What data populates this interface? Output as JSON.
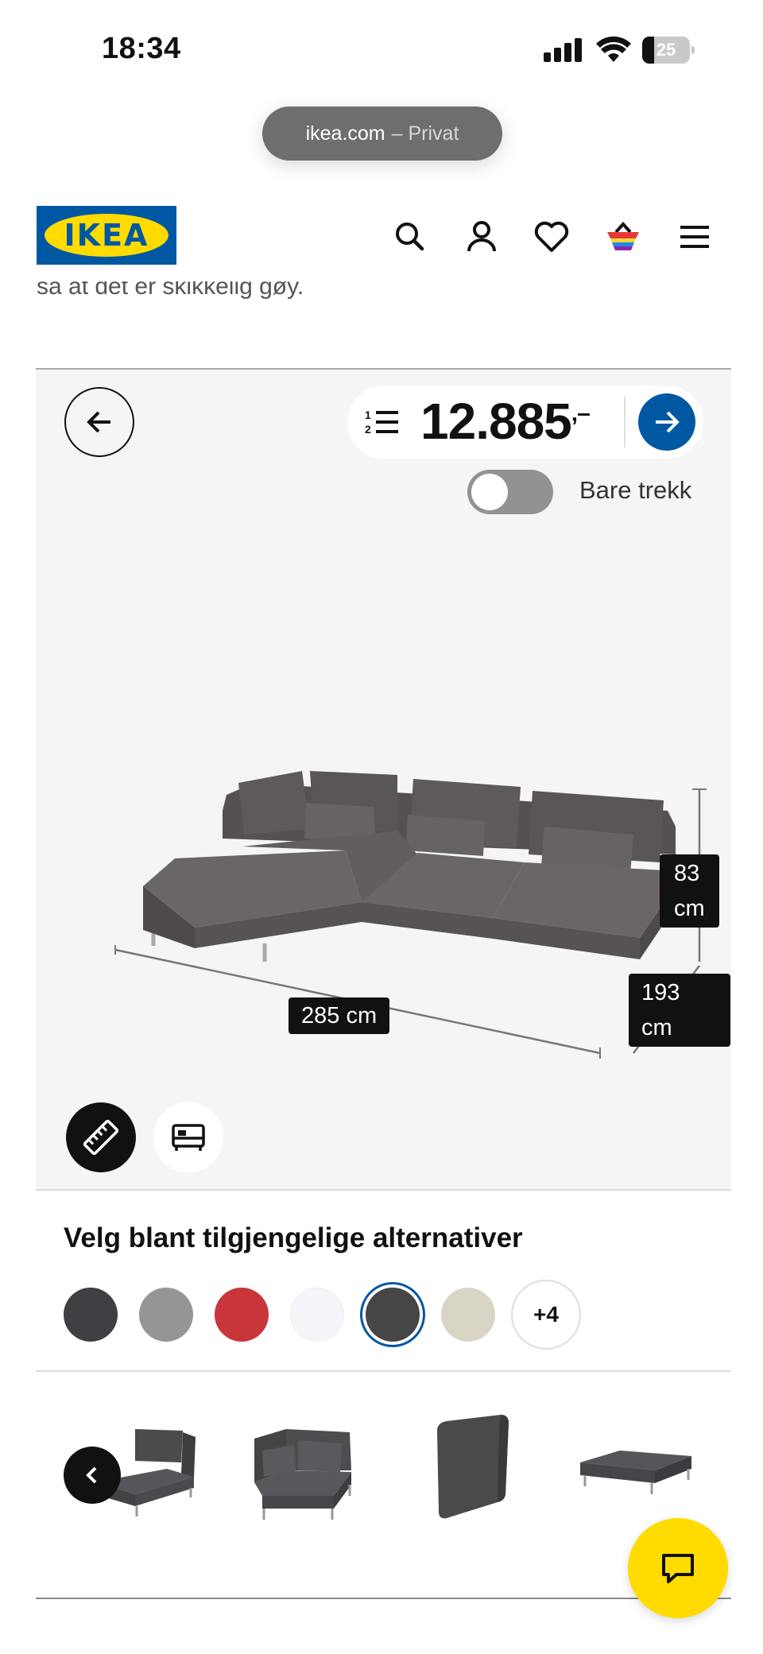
{
  "status_bar": {
    "time": "18:34",
    "battery": "25"
  },
  "browser": {
    "domain": "ikea.com",
    "mode": "– Privat"
  },
  "header": {
    "logo_text": "IKEA",
    "brand_blue": "#0058a3",
    "brand_yellow": "#ffdb00",
    "icons": [
      "search-icon",
      "account-icon",
      "heart-icon",
      "basket-icon",
      "menu-icon"
    ]
  },
  "cut_text": "så at det er skikkelig gøy.",
  "viewer": {
    "price": "12.885",
    "price_suffix": ",–",
    "toggle_label": "Bare trekk",
    "toggle_on": false,
    "dimensions": {
      "width": "285 cm",
      "height_value": "83",
      "height_unit": "cm",
      "depth_value": "193",
      "depth_unit": "cm"
    },
    "tools": [
      "ruler-icon",
      "bed-icon"
    ]
  },
  "options": {
    "title": "Velg blant tilgjengelige alternativer",
    "swatches": [
      {
        "color": "#3f3f44",
        "selected": false
      },
      {
        "color": "#959595",
        "selected": false
      },
      {
        "color": "#c8363c",
        "selected": false
      },
      {
        "color": "#f4f5f9",
        "selected": false
      },
      {
        "color": "#464646",
        "selected": true
      },
      {
        "color": "#d8d5c4",
        "selected": false
      }
    ],
    "more_label": "+4"
  },
  "thumbnails": [
    "chaise-longue-module",
    "corner-module",
    "backrest-cover",
    "footstool-module"
  ]
}
